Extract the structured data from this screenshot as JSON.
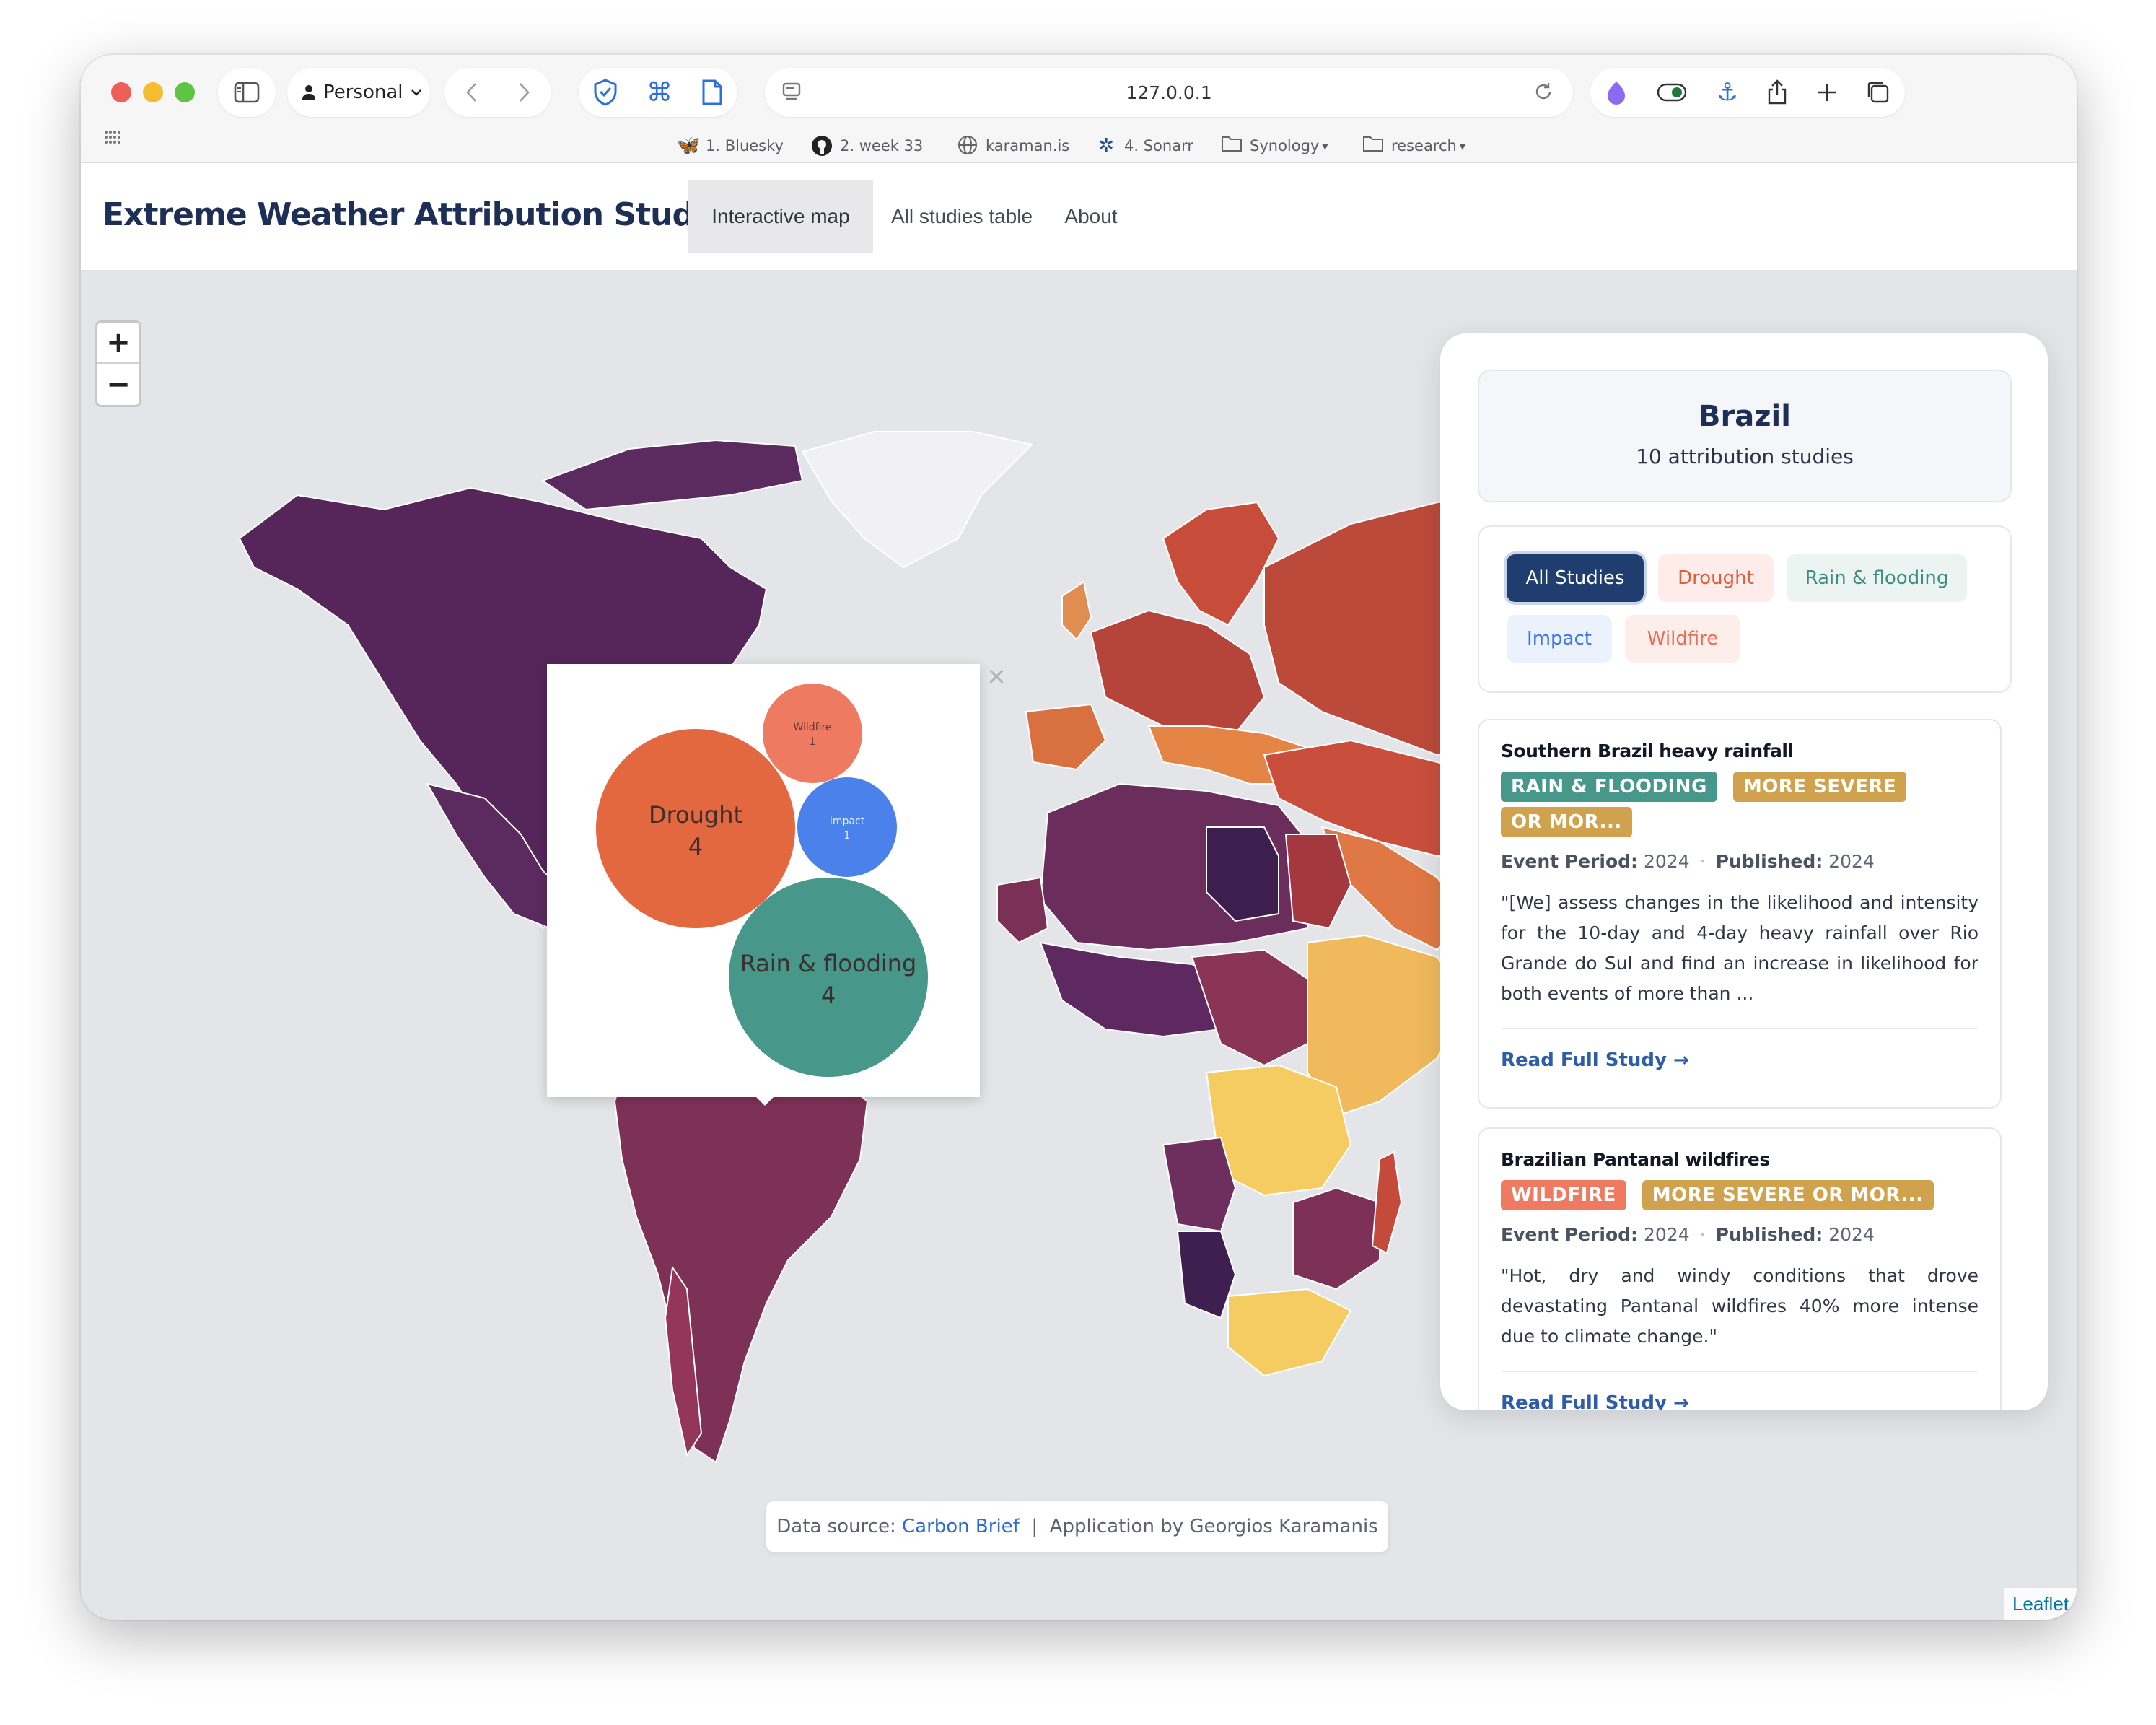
{
  "browser": {
    "profile_label": "Personal",
    "url": "127.0.0.1",
    "bookmarks": [
      {
        "label": "1. Bluesky",
        "icon": "butterfly-icon"
      },
      {
        "label": "2. week 33",
        "icon": "github-icon"
      },
      {
        "label": "karaman.is",
        "icon": "globe-icon"
      },
      {
        "label": "4. Sonarr",
        "icon": "sonarr-icon"
      },
      {
        "label": "Synology",
        "icon": "folder-icon"
      },
      {
        "label": "research",
        "icon": "folder-icon"
      }
    ]
  },
  "app": {
    "title": "Extreme Weather Attribution Studies",
    "tabs": [
      {
        "label": "Interactive map",
        "active": true
      },
      {
        "label": "All studies table",
        "active": false
      },
      {
        "label": "About",
        "active": false
      }
    ]
  },
  "map": {
    "zoom_in": "+",
    "zoom_out": "−",
    "popup": {
      "close": "×",
      "bubbles": [
        {
          "label": "Drought",
          "count": "4",
          "color": "#e4683f"
        },
        {
          "label": "Rain & flooding",
          "count": "4",
          "color": "#47978a"
        },
        {
          "label": "Wildfire",
          "count": "1",
          "color": "#ee7b61"
        },
        {
          "label": "Impact",
          "count": "1",
          "color": "#4b81ea"
        }
      ]
    },
    "attribution": "Leaflet"
  },
  "panel": {
    "country": "Brazil",
    "count_text": "10 attribution studies",
    "filters": [
      {
        "label": "All Studies",
        "active": true
      },
      {
        "label": "Drought"
      },
      {
        "label": "Rain & flooding"
      },
      {
        "label": "Impact"
      },
      {
        "label": "Wildfire"
      }
    ],
    "studies": [
      {
        "title": "Southern Brazil heavy rainfall",
        "tags": [
          {
            "label": "RAIN & FLOODING",
            "color": "#47978a"
          },
          {
            "label": "MORE SEVERE OR MOR...",
            "color": "#d1a24e"
          }
        ],
        "event_label": "Event Period:",
        "event_value": "2024",
        "published_label": "Published:",
        "published_value": "2024",
        "description": "\"[We] assess changes in the likelihood and intensity for the 10-day and 4-day heavy rainfall over Rio Grande do Sul and find an increase in likelihood for both events of more than ...",
        "link": "Read Full Study →"
      },
      {
        "title": "Brazilian Pantanal wildfires",
        "tags": [
          {
            "label": "WILDFIRE",
            "color": "#ee7b61"
          },
          {
            "label": "MORE SEVERE OR MOR...",
            "color": "#d1a24e"
          }
        ],
        "event_label": "Event Period:",
        "event_value": "2024",
        "published_label": "Published:",
        "published_value": "2024",
        "description": "\"Hot, dry and windy conditions that drove devastating Pantanal wildfires 40% more intense due to climate change.\"",
        "link": "Read Full Study →"
      }
    ]
  },
  "footer": {
    "source_label": "Data source:",
    "source_link": "Carbon Brief",
    "separator": "|",
    "author": "Application by Georgios Karamanis"
  }
}
